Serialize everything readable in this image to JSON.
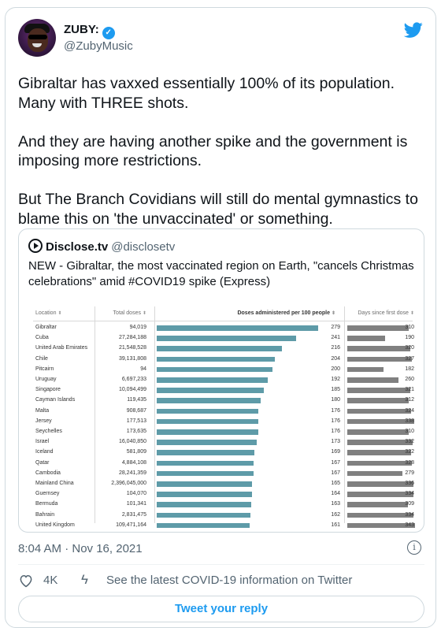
{
  "author": {
    "name": "ZUBY:",
    "handle": "@ZubyMusic"
  },
  "tweet": {
    "paragraphs": [
      "Gibraltar has vaxxed essentially 100% of its population. Many with THREE shots.",
      "And they are having another spike and the government is imposing more restrictions.",
      "But The Branch Covidians will still do mental gymnastics to blame this on 'the unvaccinated' or something."
    ],
    "timestamp": "8:04 AM · Nov 16, 2021",
    "likes": "4K",
    "covid_info": "See the latest COVID-19 information on Twitter",
    "reply_label": "Tweet your reply"
  },
  "quoted": {
    "name": "Disclose.tv",
    "handle": "@disclosetv",
    "text": "NEW - Gibraltar, the most vaccinated region on Earth, \"cancels Christmas celebrations\" amid #COVID19 spike (Express)"
  },
  "chart_data": {
    "type": "table",
    "columns": [
      "Location",
      "Total doses",
      "Doses administered per 100 people",
      "Days since first dose"
    ],
    "rows": [
      {
        "location": "Gibraltar",
        "total_doses": "94,019",
        "per_100": 279,
        "days": 310
      },
      {
        "location": "Cuba",
        "total_doses": "27,284,188",
        "per_100": 241,
        "days": 190
      },
      {
        "location": "United Arab Emirates",
        "total_doses": "21,548,528",
        "per_100": 216,
        "days": 320
      },
      {
        "location": "Chile",
        "total_doses": "39,131,808",
        "per_100": 204,
        "days": 327
      },
      {
        "location": "Pitcairn",
        "total_doses": "94",
        "per_100": 200,
        "days": 182
      },
      {
        "location": "Uruguay",
        "total_doses": "6,697,233",
        "per_100": 192,
        "days": 260
      },
      {
        "location": "Singapore",
        "total_doses": "10,094,499",
        "per_100": 185,
        "days": 321
      },
      {
        "location": "Cayman Islands",
        "total_doses": "119,435",
        "per_100": 180,
        "days": 312
      },
      {
        "location": "Malta",
        "total_doses": "908,687",
        "per_100": 176,
        "days": 324
      },
      {
        "location": "Jersey",
        "total_doses": "177,513",
        "per_100": 176,
        "days": 338
      },
      {
        "location": "Seychelles",
        "total_doses": "173,635",
        "per_100": 176,
        "days": 310
      },
      {
        "location": "Israel",
        "total_doses": "16,040,850",
        "per_100": 173,
        "days": 332
      },
      {
        "location": "Iceland",
        "total_doses": "581,809",
        "per_100": 169,
        "days": 322
      },
      {
        "location": "Qatar",
        "total_doses": "4,884,108",
        "per_100": 167,
        "days": 328
      },
      {
        "location": "Cambodia",
        "total_doses": "28,241,359",
        "per_100": 167,
        "days": 279
      },
      {
        "location": "Mainland China",
        "total_doses": "2,396,045,000",
        "per_100": 165,
        "days": 336
      },
      {
        "location": "Guernsey",
        "total_doses": "104,070",
        "per_100": 164,
        "days": 334
      },
      {
        "location": "Bermuda",
        "total_doses": "101,341",
        "per_100": 163,
        "days": 309
      },
      {
        "location": "Bahrain",
        "total_doses": "2,831,475",
        "per_100": 162,
        "days": 334
      },
      {
        "location": "United Kingdom",
        "total_doses": "109,471,164",
        "per_100": 161,
        "days": 343
      }
    ],
    "colors": {
      "per_100_bar": "#5e9ba8",
      "days_bar": "#808080"
    }
  },
  "colors": {
    "accent": "#1d9bf0",
    "muted": "#536471"
  }
}
